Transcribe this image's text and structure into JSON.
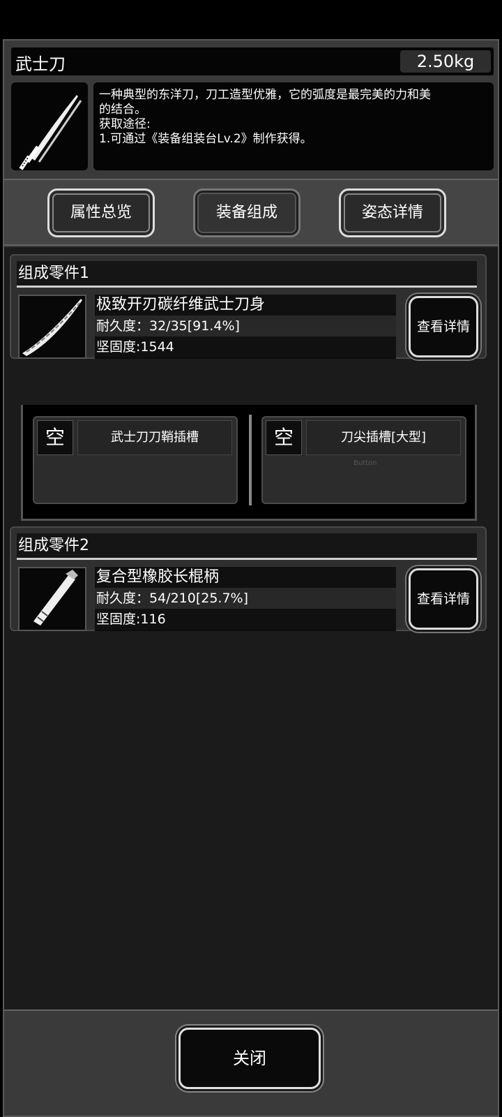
{
  "item": {
    "name": "武士刀",
    "weight": "2.50kg",
    "icon": "katana-icon",
    "description_lines": [
      "一种典型的东洋刀，刀工造型优雅，它的弧度是最完美的力和美",
      "的结合。",
      "获取途径:",
      "1.可通过《装备组装台Lv.2》制作获得。"
    ]
  },
  "tabs": [
    {
      "label": "属性总览",
      "active": false
    },
    {
      "label": "装备组成",
      "active": true
    },
    {
      "label": "姿态详情",
      "active": false
    }
  ],
  "parts": [
    {
      "header": "组成零件1",
      "icon": "blade-icon",
      "name": "极致开刃碳纤维武士刀身",
      "durability": "耐久度：32/35[91.4%]",
      "hardness": "坚固度:1544",
      "detail_label": "查看详情"
    },
    {
      "header": "组成零件2",
      "icon": "handle-icon",
      "name": "复合型橡胶长棍柄",
      "durability": "耐久度：54/210[25.7%]",
      "hardness": "坚固度:116",
      "detail_label": "查看详情"
    }
  ],
  "slots": [
    {
      "status": "空",
      "name": "武士刀刀鞘插槽"
    },
    {
      "status": "空",
      "name": "刀尖插槽[大型]",
      "ghost": "Button"
    }
  ],
  "footer": {
    "close_label": "关闭"
  }
}
